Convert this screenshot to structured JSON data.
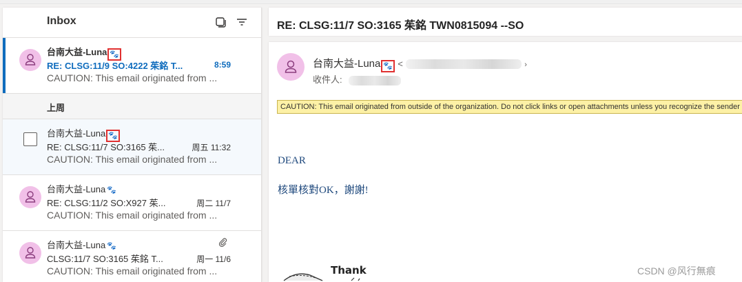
{
  "list": {
    "title": "Inbox",
    "group_label": "上周",
    "items": [
      {
        "sender": "台南大益-Luna",
        "subject": "RE: CLSG:11/9 SO:4222 茱銘 T...",
        "time": "8:59",
        "preview": "CAUTION: This email originated from ...",
        "unread": true,
        "selected": true
      },
      {
        "sender": "台南大益-Luna",
        "subject": "RE: CLSG:11/7 SO:3165 茱...",
        "time": "周五 11:32",
        "preview": "CAUTION: This email originated from ..."
      },
      {
        "sender": "台南大益-Luna",
        "subject": "RE: CLSG:11/2 SO:X927 茱...",
        "time": "周二 11/7",
        "preview": "CAUTION: This email originated from ..."
      },
      {
        "sender": "台南大益-Luna",
        "subject": "CLSG:11/7 SO:3165 茱銘 T...",
        "time": "周一 11/6",
        "preview": "CAUTION: This email originated from ..."
      }
    ]
  },
  "reading": {
    "subject": "RE: CLSG:11/7  SO:3165  茱銘  TWN0815094  --SO",
    "sender": "台南大益-Luna",
    "sender_lt": "<",
    "sender_gt": "›",
    "to_label": "收件人:",
    "caution": "CAUTION: This email originated from outside of the organization. Do not click links or open attachments unless you recognize the sender and know the content is safe.",
    "body_greeting": "DEAR",
    "body_text": "核單核對OK，謝謝!",
    "sticker_text": "Thank"
  },
  "watermark": "CSDN @风行無痕",
  "colors": {
    "accent": "#0f6cbd",
    "avatar_bg": "#f1c0e8",
    "caution_bg": "#fdf1a6",
    "highlight_box": "#e03030"
  }
}
